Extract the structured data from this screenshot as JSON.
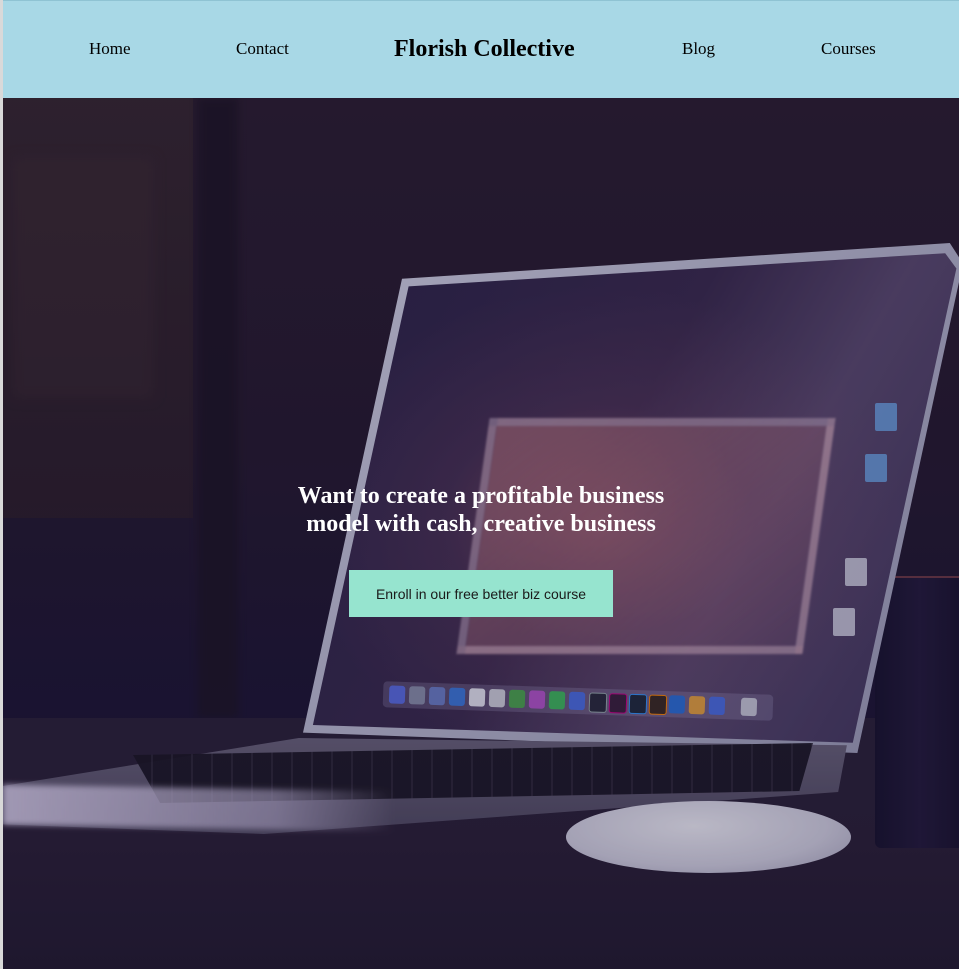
{
  "header": {
    "brand": "Florish Collective",
    "nav": {
      "home": "Home",
      "contact": "Contact",
      "blog": "Blog",
      "courses": "Courses"
    },
    "background_color": "#a8d8e6"
  },
  "hero": {
    "heading_line1": "Want to create a profitable business",
    "heading_line2": "model with cash, creative business",
    "cta_label": "Enroll in our free better biz course",
    "cta_color": "#96e4cf",
    "background_image": "laptop-on-desk-photo"
  }
}
